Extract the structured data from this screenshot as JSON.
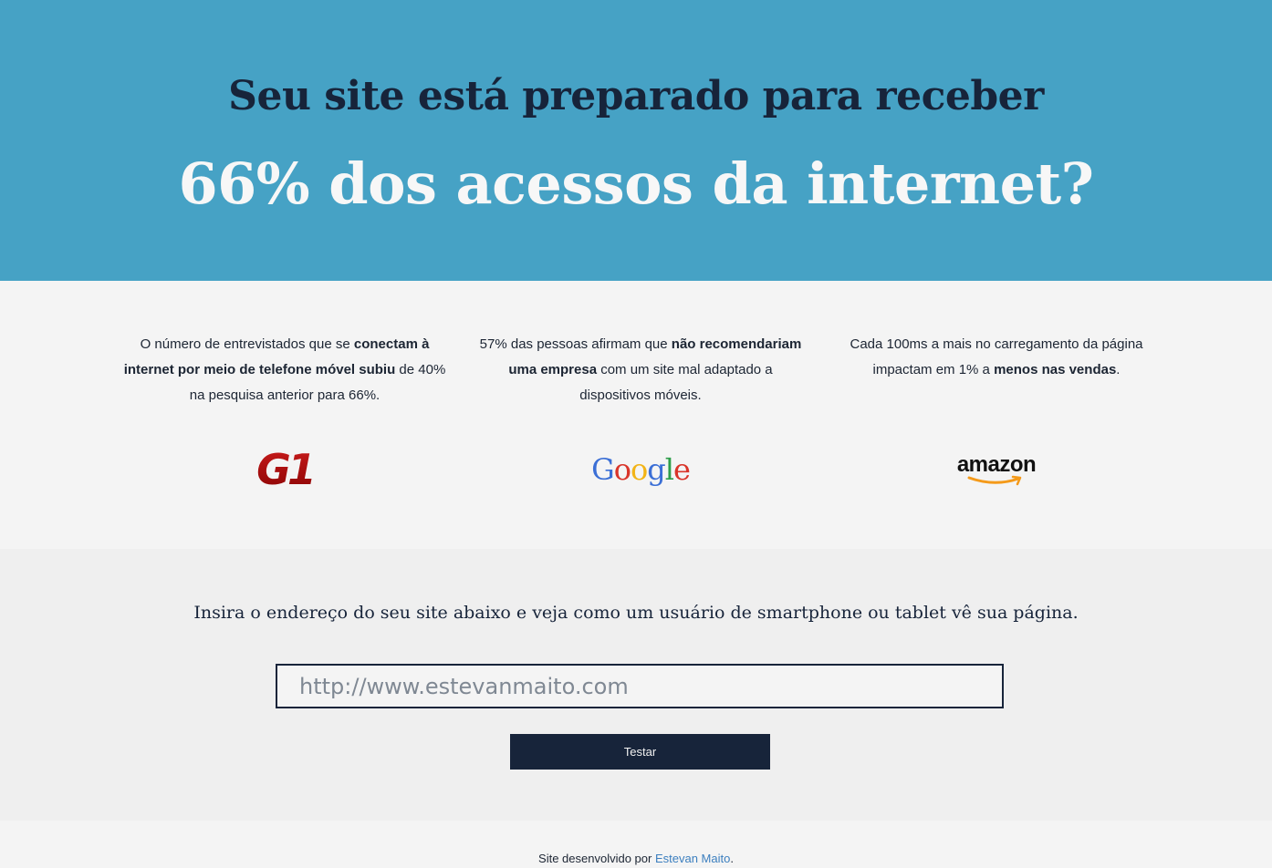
{
  "hero": {
    "title": "Seu site está preparado para receber",
    "subtitle": "66% dos acessos da internet?"
  },
  "stats": [
    {
      "parts": [
        "O número de entrevistados que se ",
        "conectam à internet por meio de telefone móvel subiu",
        " de 40% na pesquisa anterior para 66%."
      ],
      "logo_text": "G1",
      "logo_icon": "g1-logo"
    },
    {
      "parts": [
        "57% das pessoas afirmam que ",
        "não recomendariam uma empresa",
        " com um site mal adaptado a dispositivos móveis."
      ],
      "logo_text": "Google",
      "logo_icon": "google-logo"
    },
    {
      "parts": [
        "Cada 100ms a mais no carregamento da página impactam em 1% a ",
        "menos nas vendas",
        "."
      ],
      "logo_text": "amazon",
      "logo_icon": "amazon-logo"
    }
  ],
  "tester": {
    "heading": "Insira o endereço do seu site abaixo e veja como um usuário de smartphone ou tablet vê sua página.",
    "placeholder": "http://www.estevanmaito.com",
    "value": "",
    "button_label": "Testar"
  },
  "footer": {
    "prefix": "Site desenvolvido por ",
    "link_text": "Estevan Maito",
    "suffix": "."
  },
  "colors": {
    "hero_bg": "#46a2c5",
    "navy": "#17243a",
    "link": "#3c7fbf",
    "g1_red": "#b00e0e",
    "amazon_orange": "#f49a1a"
  }
}
